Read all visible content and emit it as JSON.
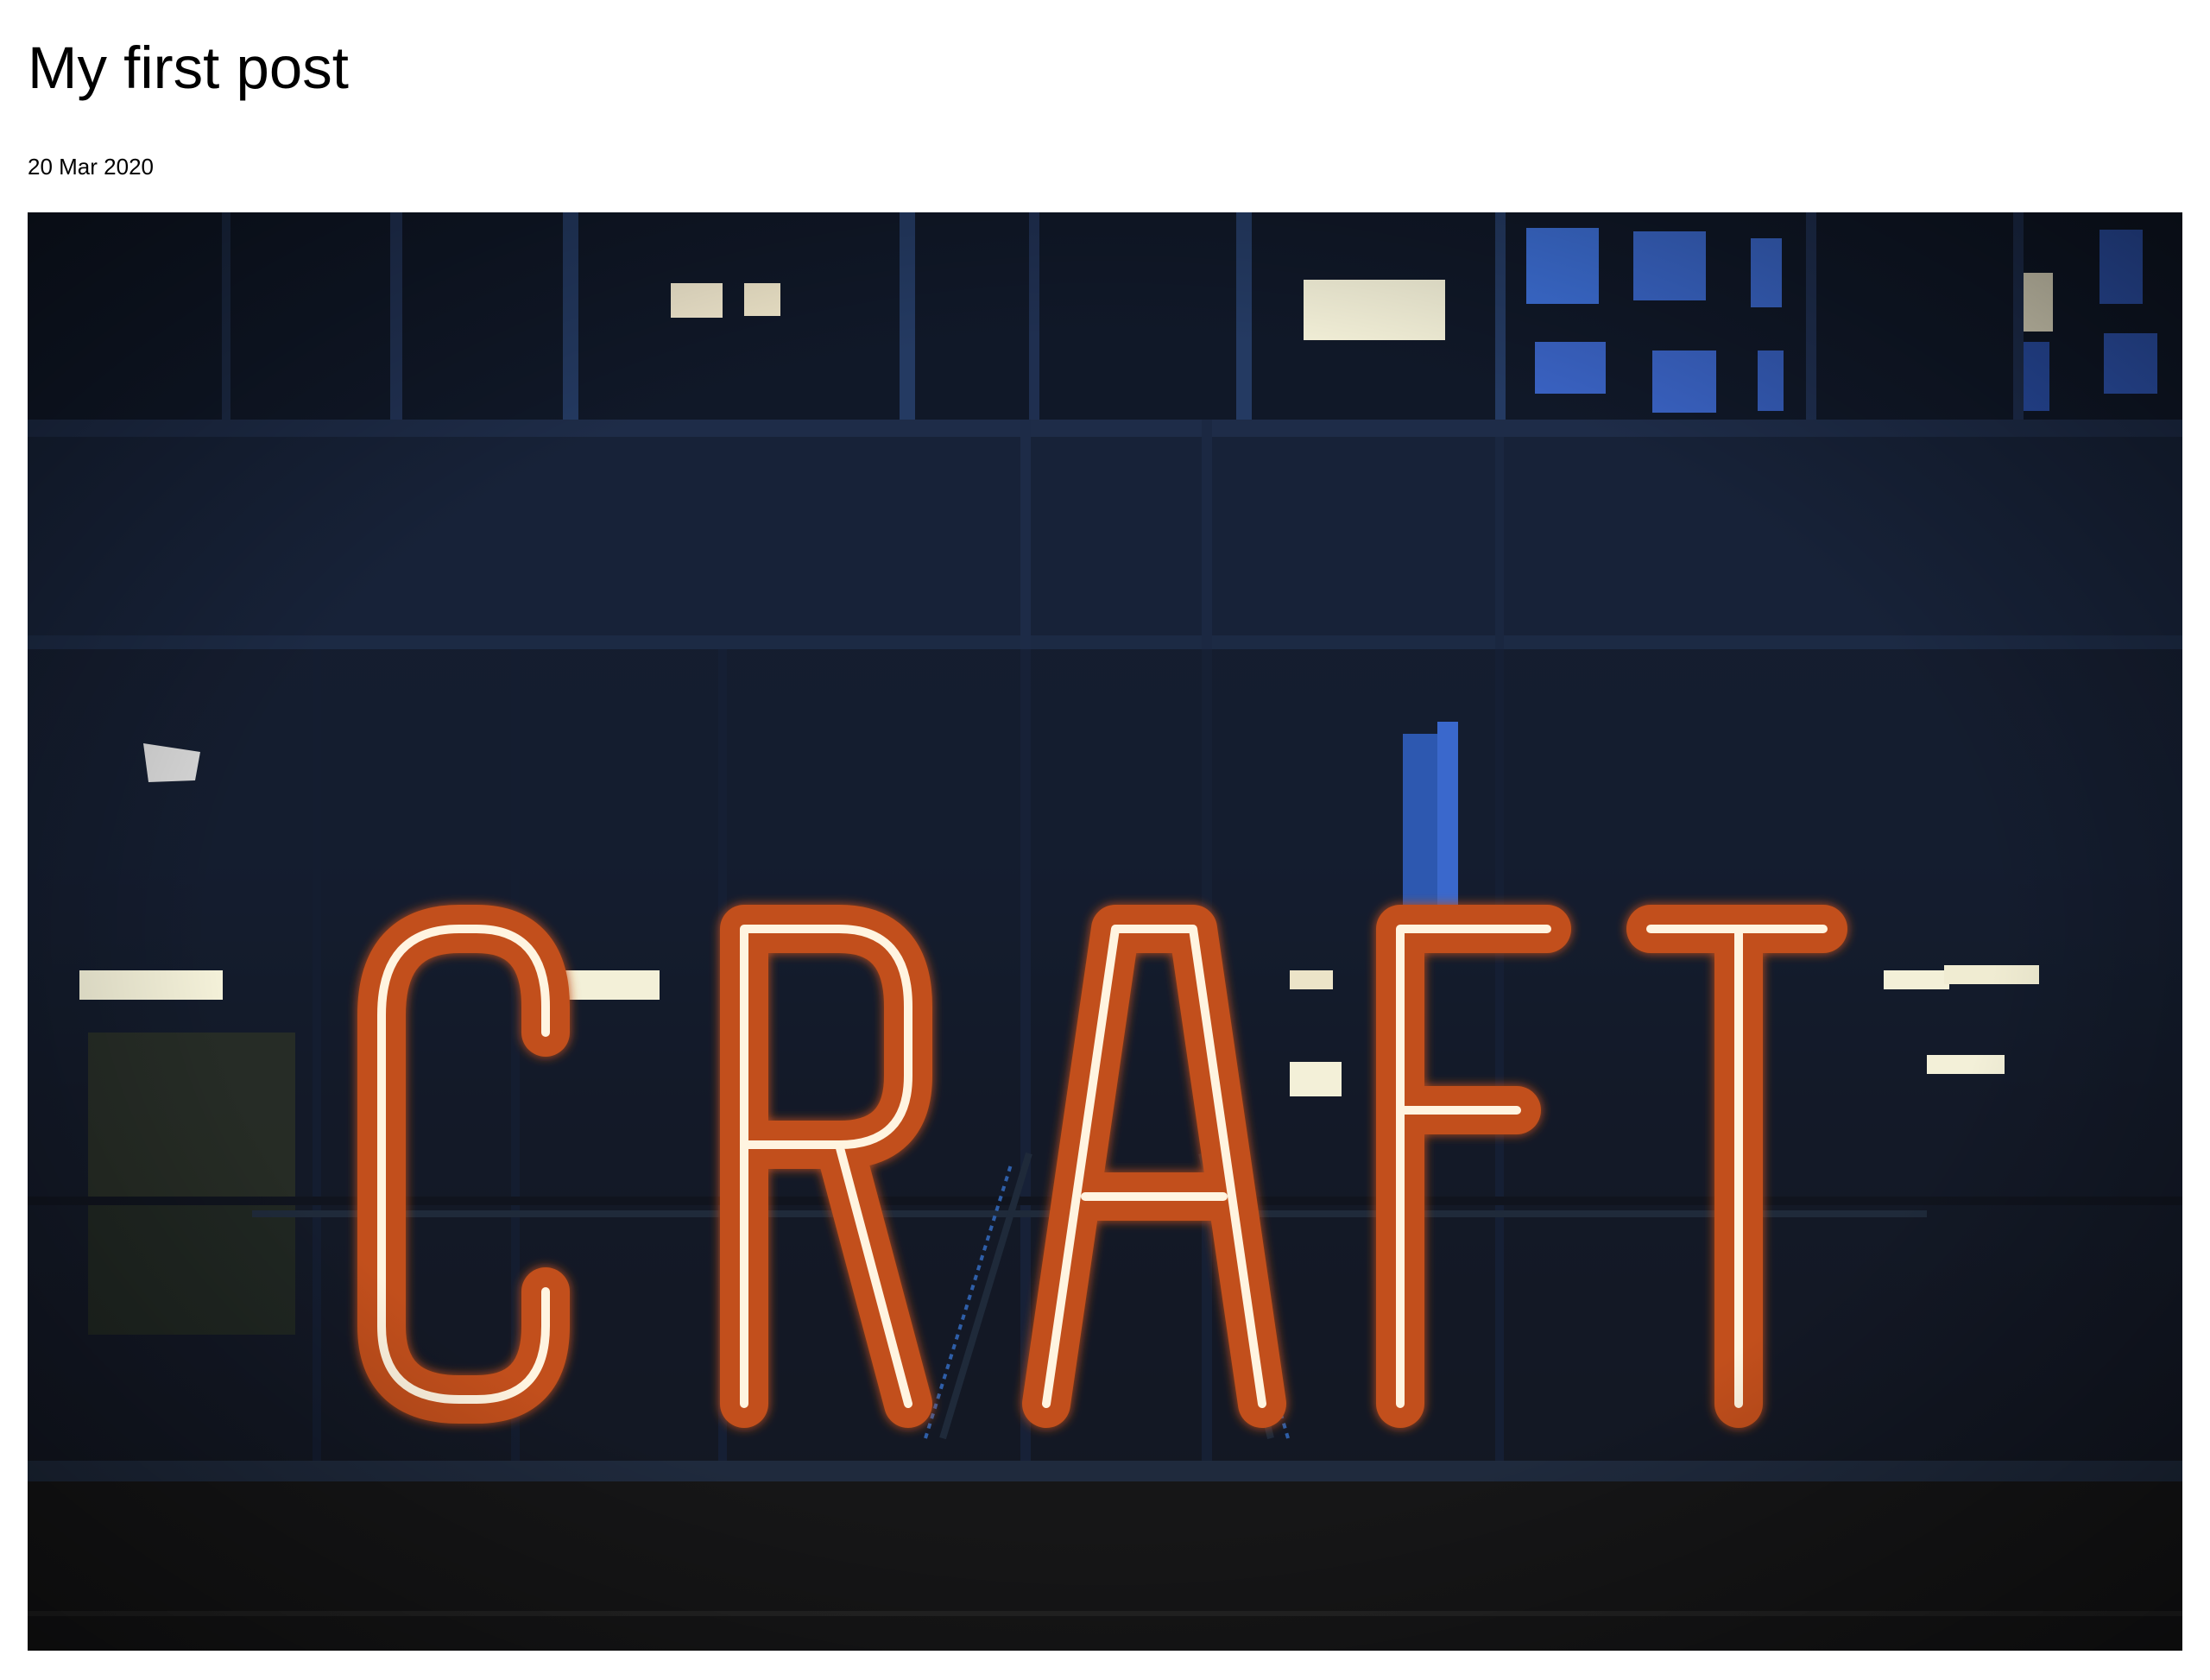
{
  "post": {
    "title": "My first post",
    "date": "20 Mar 2020"
  },
  "hero_image": {
    "sign_text": "CRAFT",
    "colors": {
      "background": "#141820",
      "building_blue": "#1b2a45",
      "neon_orange": "#d4581a",
      "neon_core": "#fff4e0",
      "window_light": "#f3f0d8",
      "window_blue": "#3d6fd6"
    }
  }
}
